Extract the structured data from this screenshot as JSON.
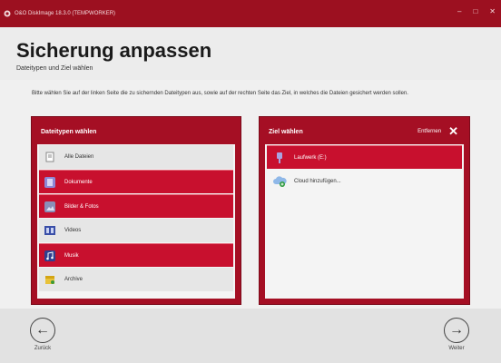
{
  "window": {
    "title": "O&O DiskImage 18.3.0 (TEMPWORKER)"
  },
  "header": {
    "title": "Sicherung anpassen",
    "subtitle": "Dateitypen und Ziel wählen"
  },
  "instructions": "Bitte wählen Sie auf der linken Seite die zu sichernden Dateitypen aus, sowie auf der rechten Seite das Ziel, in welches die Dateien gesichert werden sollen.",
  "left_panel": {
    "heading": "Dateitypen wählen",
    "items": [
      {
        "label": "Alle Dateien",
        "selected": false,
        "icon": "all-files-icon"
      },
      {
        "label": "Dokumente",
        "selected": true,
        "icon": "documents-icon"
      },
      {
        "label": "Bilder & Fotos",
        "selected": true,
        "icon": "pictures-icon"
      },
      {
        "label": "Videos",
        "selected": false,
        "icon": "videos-icon"
      },
      {
        "label": "Musik",
        "selected": true,
        "icon": "music-icon"
      },
      {
        "label": "Archive",
        "selected": false,
        "icon": "archive-icon"
      }
    ]
  },
  "right_panel": {
    "heading": "Ziel wählen",
    "clear_label": "Entfernen",
    "items": [
      {
        "label": "Laufwerk (E:)",
        "selected": true,
        "icon": "drive-icon"
      },
      {
        "label": "Cloud hinzufügen...",
        "selected": false,
        "icon": "cloud-add-icon"
      }
    ]
  },
  "footer": {
    "back_label": "Zurück",
    "next_label": "Weiter"
  },
  "colors": {
    "accent": "#c8102e",
    "panel": "#a50f24",
    "titlebar": "#9c1020"
  }
}
